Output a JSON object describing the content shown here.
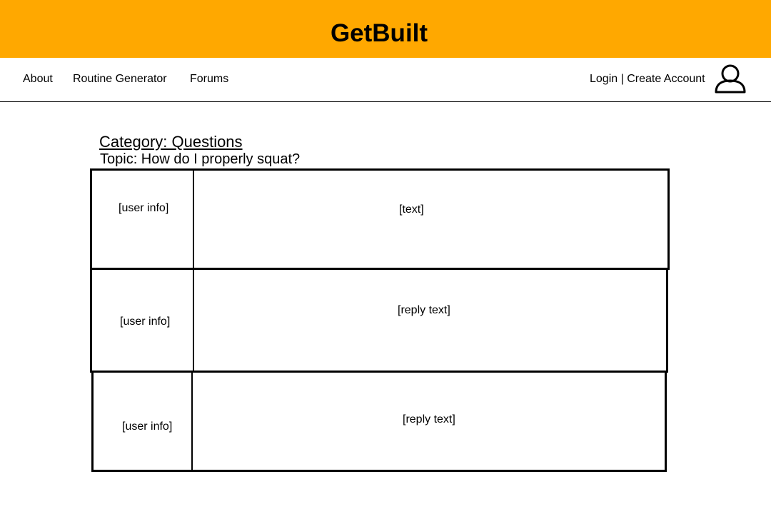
{
  "header": {
    "title": "GetBuilt",
    "background_color": "#FFA800"
  },
  "nav": {
    "about": "About",
    "routine_generator": "Routine Generator",
    "forums": "Forums",
    "login": "Login",
    "separator": " | ",
    "create_account": "Create Account",
    "account_icon": "user-icon"
  },
  "thread": {
    "category": "Category: Questions",
    "topic": "Topic: How do I properly squat?",
    "posts": [
      {
        "user_info": "[user info]",
        "text": "[text]"
      },
      {
        "user_info": "[user info]",
        "text": "[reply text]"
      },
      {
        "user_info": "[user info]",
        "text": "[reply text]"
      }
    ]
  }
}
